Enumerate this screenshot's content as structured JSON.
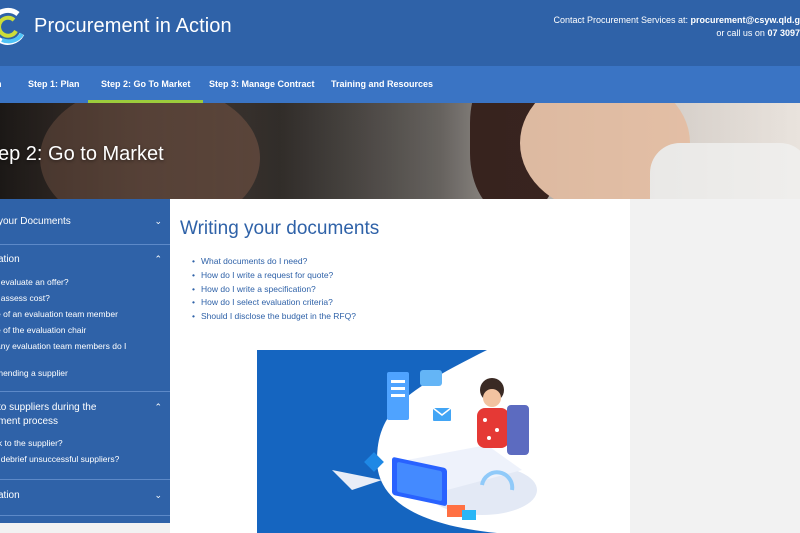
{
  "header": {
    "site_title": "Procurement in Action",
    "contact_line1_prefix": "Contact Procurement Services at:",
    "contact_email": "procurement@csyw.qld.g",
    "contact_line2_prefix": "or call us on",
    "contact_phone": "07 3097"
  },
  "nav": {
    "items": [
      {
        "label": "n"
      },
      {
        "label": "Step 1: Plan"
      },
      {
        "label": "Step 2: Go To Market"
      },
      {
        "label": "Step 3: Manage Contract"
      },
      {
        "label": "Training and Resources"
      }
    ],
    "active_index": 2
  },
  "hero": {
    "title": "ep 2: Go to Market"
  },
  "sidebar": {
    "sections": [
      {
        "title": "your Documents",
        "links": []
      },
      {
        "title": "ation",
        "links": [
          "I evaluate an offer?",
          "I assess cost?",
          "e of an evaluation team member",
          "e of the evaluation chair",
          "any evaluation team members do I",
          "mending a supplier"
        ]
      },
      {
        "title_line1": "to suppliers during the",
        "title_line2": "ment process",
        "links": [
          "lk to the supplier?",
          "I debrief unsuccessful suppliers?"
        ]
      },
      {
        "title": "ation",
        "links": []
      }
    ]
  },
  "content": {
    "heading": "Writing your documents",
    "links": [
      "What documents do I need?",
      "How do I write a request for quote?",
      "How do I write a specification?",
      "How do I select evaluation criteria?",
      "Should I disclose the budget in the RFQ?"
    ]
  },
  "colors": {
    "header_bg": "#2f62a8",
    "nav_bg": "#3a74c4",
    "active_underline": "#9ccc3c",
    "link": "#2f62a8"
  }
}
